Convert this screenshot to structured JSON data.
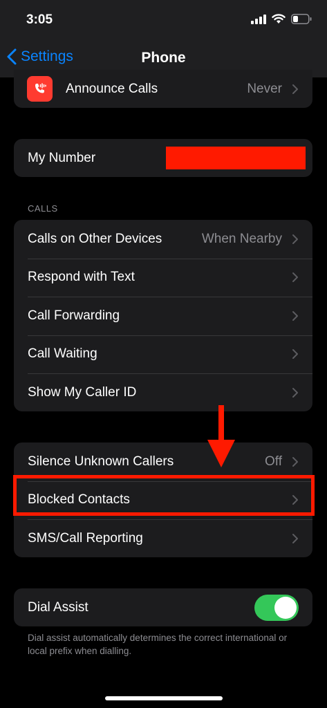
{
  "status_bar": {
    "time": "3:05"
  },
  "nav": {
    "back_label": "Settings",
    "title": "Phone"
  },
  "top_group": {
    "announce_label": "Announce Calls",
    "announce_value": "Never"
  },
  "number_group": {
    "label": "My Number"
  },
  "calls_section": {
    "header": "CALLS",
    "rows": [
      {
        "label": "Calls on Other Devices",
        "value": "When Nearby"
      },
      {
        "label": "Respond with Text",
        "value": ""
      },
      {
        "label": "Call Forwarding",
        "value": ""
      },
      {
        "label": "Call Waiting",
        "value": ""
      },
      {
        "label": "Show My Caller ID",
        "value": ""
      }
    ]
  },
  "blocking_section": {
    "rows": [
      {
        "label": "Silence Unknown Callers",
        "value": "Off"
      },
      {
        "label": "Blocked Contacts",
        "value": ""
      },
      {
        "label": "SMS/Call Reporting",
        "value": ""
      }
    ]
  },
  "dial_assist": {
    "label": "Dial Assist",
    "enabled": true,
    "footer": "Dial assist automatically determines the correct international or local prefix when dialling."
  },
  "colors": {
    "accent": "#0a84ff",
    "toggle_on": "#34c759",
    "annotation": "#ff1a00",
    "row_bg": "#1c1c1e"
  },
  "icons": [
    "signal-icon",
    "wifi-icon",
    "battery-icon",
    "chevron-left-icon",
    "chevron-right-icon",
    "announce-calls-icon",
    "arrow-down-icon"
  ]
}
